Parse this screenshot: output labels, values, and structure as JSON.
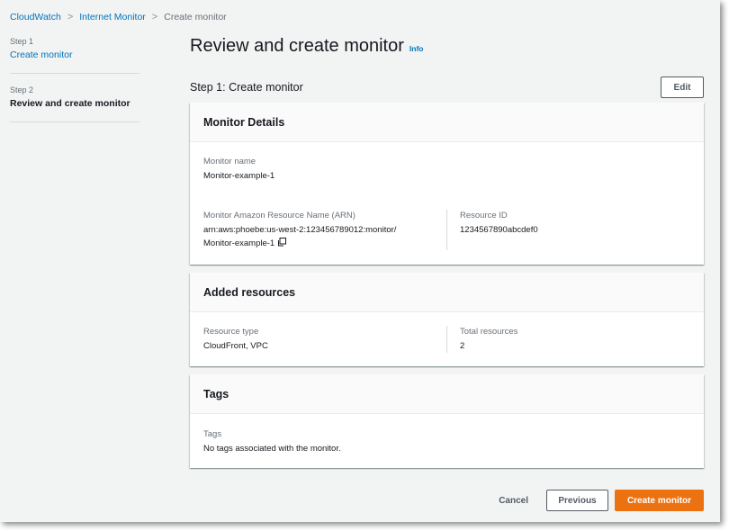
{
  "breadcrumb": {
    "items": [
      "CloudWatch",
      "Internet Monitor"
    ],
    "current": "Create monitor",
    "separator": ">"
  },
  "sidebar": {
    "steps": [
      {
        "number": "Step 1",
        "label": "Create monitor"
      },
      {
        "number": "Step 2",
        "label": "Review and create monitor"
      }
    ]
  },
  "page": {
    "title": "Review and create monitor",
    "info_label": "Info"
  },
  "step1": {
    "title": "Step 1: Create monitor",
    "edit_label": "Edit"
  },
  "monitor_details": {
    "title": "Monitor Details",
    "name_label": "Monitor name",
    "name_value": "Monitor-example-1",
    "arn_label": "Monitor Amazon Resource Name (ARN)",
    "arn_value_line1": "arn:aws:phoebe:us-west-2:123456789012:monitor/",
    "arn_value_line2": "Monitor-example-1",
    "resource_id_label": "Resource ID",
    "resource_id_value": "1234567890abcdef0"
  },
  "added_resources": {
    "title": "Added resources",
    "type_label": "Resource type",
    "type_value": "CloudFront, VPC",
    "total_label": "Total resources",
    "total_value": "2"
  },
  "tags": {
    "title": "Tags",
    "label": "Tags",
    "value": "No tags associated with the monitor."
  },
  "footer": {
    "cancel_label": "Cancel",
    "previous_label": "Previous",
    "create_label": "Create monitor"
  },
  "colors": {
    "link": "#0073bb",
    "primary": "#ec7211",
    "background": "#f2f3f3"
  },
  "icons": {
    "breadcrumb_separator": "chevron-right-icon",
    "copy": "copy-icon"
  }
}
